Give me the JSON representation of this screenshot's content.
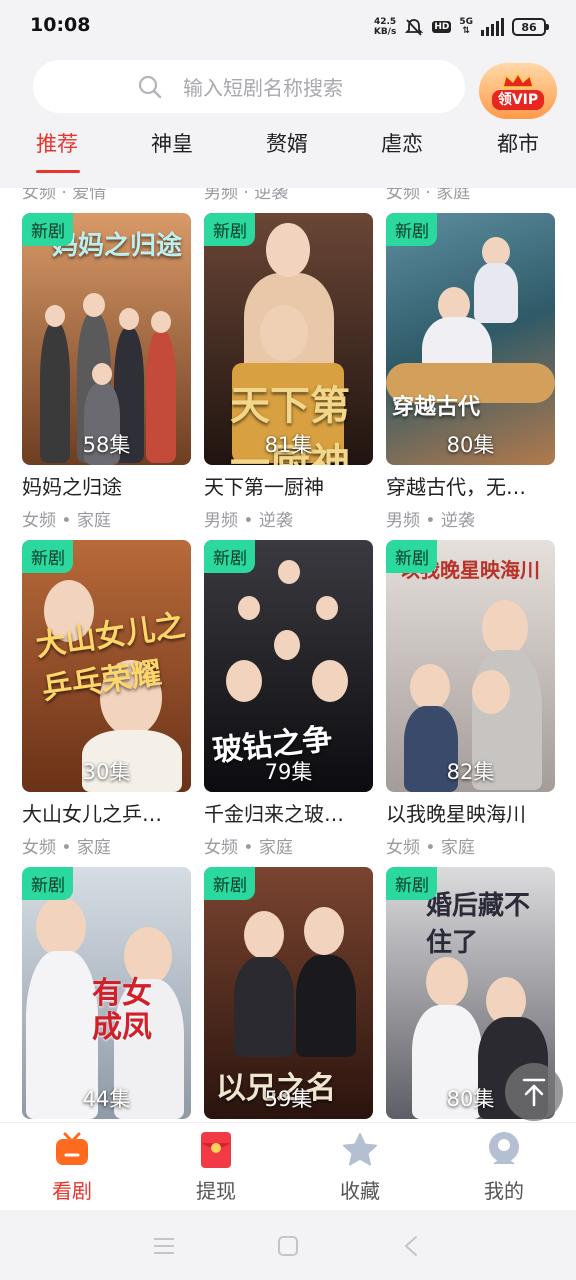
{
  "status_bar": {
    "time": "10:08",
    "net_speed_value": "42.5",
    "net_speed_unit": "KB/s",
    "hd": "HD",
    "network": "5G",
    "battery": "86"
  },
  "search": {
    "placeholder": "输入短剧名称搜索",
    "vip_label": "领VIP"
  },
  "tabs": [
    {
      "label": "推荐",
      "active": true
    },
    {
      "label": "神皇"
    },
    {
      "label": "赘婿"
    },
    {
      "label": "虐恋"
    },
    {
      "label": "都市"
    }
  ],
  "peek_row": [
    "女频 · 爱情",
    "男频 · 逆袭",
    "女频 · 家庭"
  ],
  "new_tag": "新剧",
  "dramas": [
    {
      "title": "妈妈之归途",
      "meta": "女频 • 家庭",
      "episodes": "58集",
      "poster_text": "妈妈之归途",
      "colors": [
        "#c98a5a",
        "#7a4a2e"
      ]
    },
    {
      "title": "天下第一厨神",
      "meta": "男频 • 逆袭",
      "episodes": "81集",
      "poster_text": "天下第一厨神",
      "colors": [
        "#5b3a2a",
        "#2a1a12"
      ]
    },
    {
      "title": "穿越古代，无…",
      "meta": "男频 • 逆袭",
      "episodes": "80集",
      "poster_text": "穿越古代",
      "colors": [
        "#3f6f80",
        "#b98a5c"
      ]
    },
    {
      "title": "大山女儿之乒…",
      "meta": "女频 • 家庭",
      "episodes": "30集",
      "poster_text": "大山女儿之乒乓荣耀",
      "colors": [
        "#a8562a",
        "#5a2a14"
      ]
    },
    {
      "title": "千金归来之玻…",
      "meta": "女频 • 家庭",
      "episodes": "79集",
      "poster_text": "玻钻之争",
      "colors": [
        "#2a2a2e",
        "#0e0e12"
      ]
    },
    {
      "title": "以我晚星映海川",
      "meta": "女频 • 家庭",
      "episodes": "82集",
      "poster_text": "以我晚星映海川",
      "colors": [
        "#d9d4d0",
        "#8a8480"
      ]
    },
    {
      "title": "",
      "meta": "",
      "episodes": "44集",
      "poster_text": "有女成凤",
      "colors": [
        "#cfd6de",
        "#7c8a96"
      ]
    },
    {
      "title": "",
      "meta": "",
      "episodes": "59集",
      "poster_text": "以兄之名",
      "colors": [
        "#6a3a2a",
        "#2a1410"
      ]
    },
    {
      "title": "",
      "meta": "",
      "episodes": "80集",
      "poster_text": "婚后藏不住了",
      "colors": [
        "#d6d6d8",
        "#6a6a70"
      ]
    }
  ],
  "bottom_nav": [
    {
      "label": "看剧",
      "icon": "tv-icon",
      "active": true
    },
    {
      "label": "提现",
      "icon": "red-envelope-icon"
    },
    {
      "label": "收藏",
      "icon": "star-icon"
    },
    {
      "label": "我的",
      "icon": "profile-icon"
    }
  ],
  "colors": {
    "accent": "#e8362c",
    "new_tag": "#2bd89d"
  }
}
